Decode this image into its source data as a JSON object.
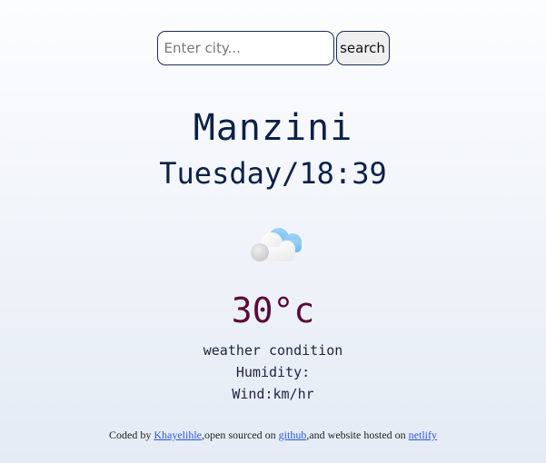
{
  "search": {
    "placeholder": "Enter city...",
    "value": "",
    "button_label": "search"
  },
  "location": {
    "city": "Manzini",
    "datetime": "Tuesday/18:39"
  },
  "weather": {
    "icon": "cloud-icon",
    "temperature": "30°c",
    "condition": "weather condition",
    "humidity": "Humidity:",
    "wind": "Wind:km/hr"
  },
  "footer": {
    "prefix": "Coded by ",
    "author_link": "Khayelihle",
    "middle": ",open sourced on ",
    "github_link": "github",
    "middle2": ",and website hosted on ",
    "netlify_link": "netlify"
  }
}
